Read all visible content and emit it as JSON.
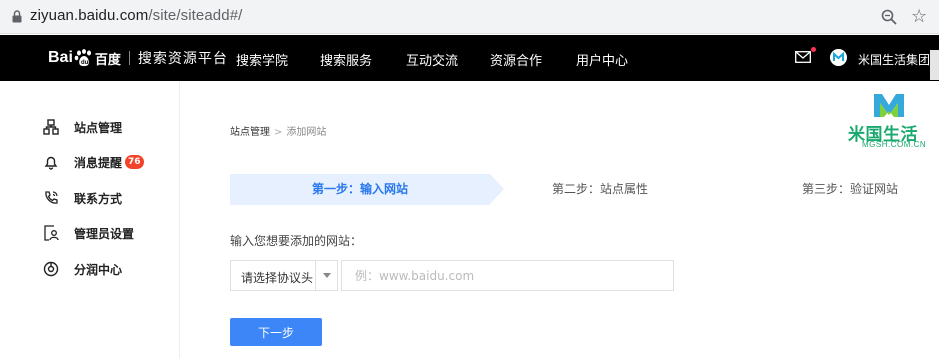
{
  "browser": {
    "url_domain": "ziyuan.baidu.com",
    "url_path": "/site/siteadd#/"
  },
  "topnav": {
    "logo_bai": "Bai",
    "logo_du": "百度",
    "platform": "搜索资源平台",
    "items": [
      "搜索学院",
      "搜索服务",
      "互动交流",
      "资源合作",
      "用户中心"
    ],
    "user_name": "米国生活集团"
  },
  "sidebar": {
    "items": [
      {
        "label": "站点管理",
        "icon": "site-manage-icon"
      },
      {
        "label": "消息提醒",
        "icon": "bell-icon",
        "badge": "76"
      },
      {
        "label": "联系方式",
        "icon": "phone-icon"
      },
      {
        "label": "管理员设置",
        "icon": "admin-icon"
      },
      {
        "label": "分润中心",
        "icon": "revenue-icon"
      }
    ]
  },
  "breadcrumb": {
    "root": "站点管理",
    "separator": ">",
    "current": "添加网站"
  },
  "watermark": {
    "name": "米国生活",
    "sub": "MGSH.COM.CN"
  },
  "steps": [
    {
      "label": "第一步：输入网站",
      "active": true
    },
    {
      "label": "第二步：站点属性",
      "active": false
    },
    {
      "label": "第三步：验证网站",
      "active": false
    }
  ],
  "form": {
    "field_label": "输入您想要添加的网站：",
    "protocol_value": "请选择协议头",
    "site_placeholder": "例：www.baidu.com",
    "next_label": "下一步"
  },
  "colors": {
    "accent": "#3c86f7",
    "step_active_bg": "#e6f0ff",
    "brand_green": "#1aa86f",
    "badge_red": "#f2442b"
  }
}
